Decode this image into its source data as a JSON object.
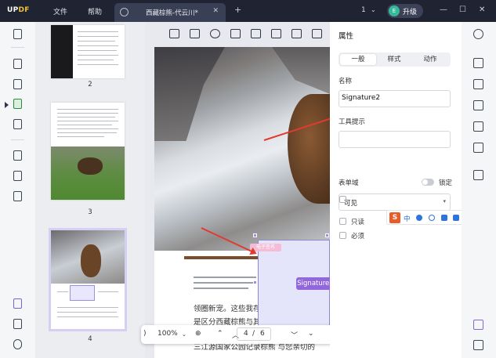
{
  "app": {
    "logo_part1": "UP",
    "logo_part2": "DF",
    "menu": [
      "文件",
      "帮助"
    ],
    "tab_title": "西藏棕熊-代云川*",
    "tab_close": "✕",
    "new_tab": "+",
    "page_count": "1",
    "user_initial": "E",
    "upgrade_label": "升级",
    "window_controls": [
      "—",
      "☐",
      "✕"
    ]
  },
  "thumbnails": {
    "pages": [
      "2",
      "3",
      "4"
    ]
  },
  "document": {
    "field_tag": "电子签名",
    "signature_label": "Signature2",
    "body_lines": [
      "领圈新宠。这些我存的特征。一合影冤和",
      "是区分西藏棕熊与其他棕熊    棕熊每天饮",
      "三江源国家公园记录棕熊    与您亲切的"
    ]
  },
  "zoom_toolbar": {
    "zoom_value": "100%",
    "current_page": "4",
    "separator": "/",
    "total_pages": "6"
  },
  "properties": {
    "panel_title": "属性",
    "tabs": [
      "一般",
      "样式",
      "动作"
    ],
    "name_label": "名称",
    "name_value": "Signature2",
    "tooltip_label": "工具提示",
    "tooltip_value": "",
    "form_field_label": "表单域",
    "lock_label": "锁定",
    "visibility_value": "可见",
    "readonly_label": "只读",
    "required_label": "必须"
  },
  "ime": {
    "logo": "S",
    "mode": "中"
  },
  "colors": {
    "accent_purple": "#9267dc",
    "arrow_red": "#e23a2e",
    "titlebar_bg": "#1f2332"
  }
}
